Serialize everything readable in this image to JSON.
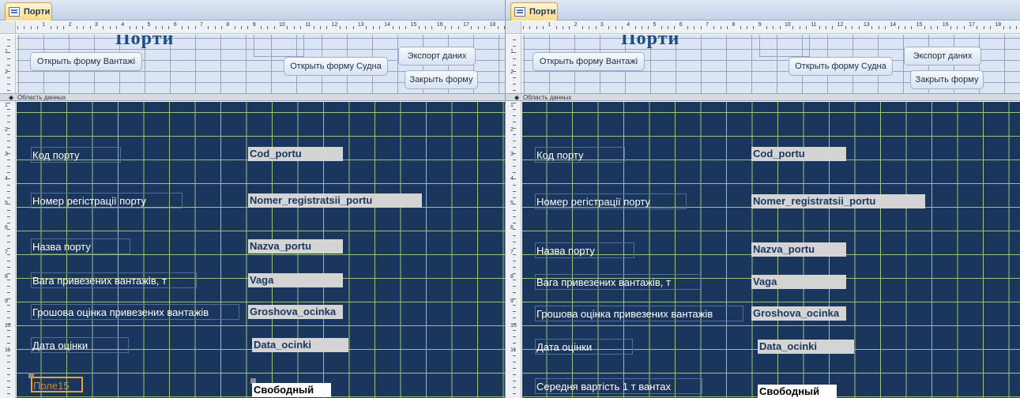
{
  "left": {
    "tab_label": "Порти",
    "header_title": "Порти",
    "buttons": {
      "open_cargo": "Открыть форму Вантажі",
      "open_ships": "Открыть форму Судна",
      "export": "Экспорт даних",
      "close": "Закрыть форму"
    },
    "section_label": "Область данных",
    "labels": {
      "port_code": "Код порту",
      "reg_number": "Номер регістрації порту",
      "port_name": "Назва порту",
      "cargo_weight": "Вага привезених вантажів, т",
      "cargo_value": "Грошова оцінка привезених вантажів",
      "eval_date": "Дата оцінки",
      "field15": "Поле15"
    },
    "fields": {
      "port_code": "Cod_portu",
      "reg_number": "Nomer_registratsii_portu",
      "port_name": "Nazva_portu",
      "cargo_weight": "Vaga",
      "cargo_value": "Groshova_ocinka",
      "eval_date": "Data_ocinki",
      "free": "Свободный"
    }
  },
  "right": {
    "tab_label": "Порти",
    "header_title": "Порти",
    "buttons": {
      "open_cargo": "Открыть форму Вантажі",
      "open_ships": "Открыть форму Судна",
      "export": "Экспорт даних",
      "close": "Закрыть форму"
    },
    "section_label": "Область данных",
    "labels": {
      "port_code": "Код порту",
      "reg_number": "Номер регістрації порту",
      "port_name": "Назва порту",
      "cargo_weight": "Вага привезених вантажів, т",
      "cargo_value": "Грошова оцінка привезених вантажів",
      "eval_date": "Дата оцінки",
      "avg_cost": "Середня вартість 1 т вантах"
    },
    "fields": {
      "port_code": "Cod_portu",
      "reg_number": "Nomer_registratsii_portu",
      "port_name": "Nazva_portu",
      "cargo_weight": "Vaga",
      "cargo_value": "Groshova_ocinka",
      "eval_date": "Data_ocinki",
      "free": "Свободный"
    }
  },
  "ruler": {
    "top_numbers": [
      "1",
      "2",
      "3",
      "4",
      "5",
      "6",
      "7",
      "8",
      "9",
      "10",
      "11",
      "12",
      "13",
      "14",
      "15",
      "16",
      "17",
      "18"
    ],
    "left_numbers": [
      "1",
      "2",
      "1",
      "2",
      "3",
      "4",
      "5",
      "6",
      "7",
      "8",
      "9",
      "10",
      "11"
    ]
  },
  "colors": {
    "detail_background": "#1b365d",
    "grid_lines": "#9fc27a",
    "header_background": "#dbe5f3",
    "selection": "#f0a030"
  }
}
